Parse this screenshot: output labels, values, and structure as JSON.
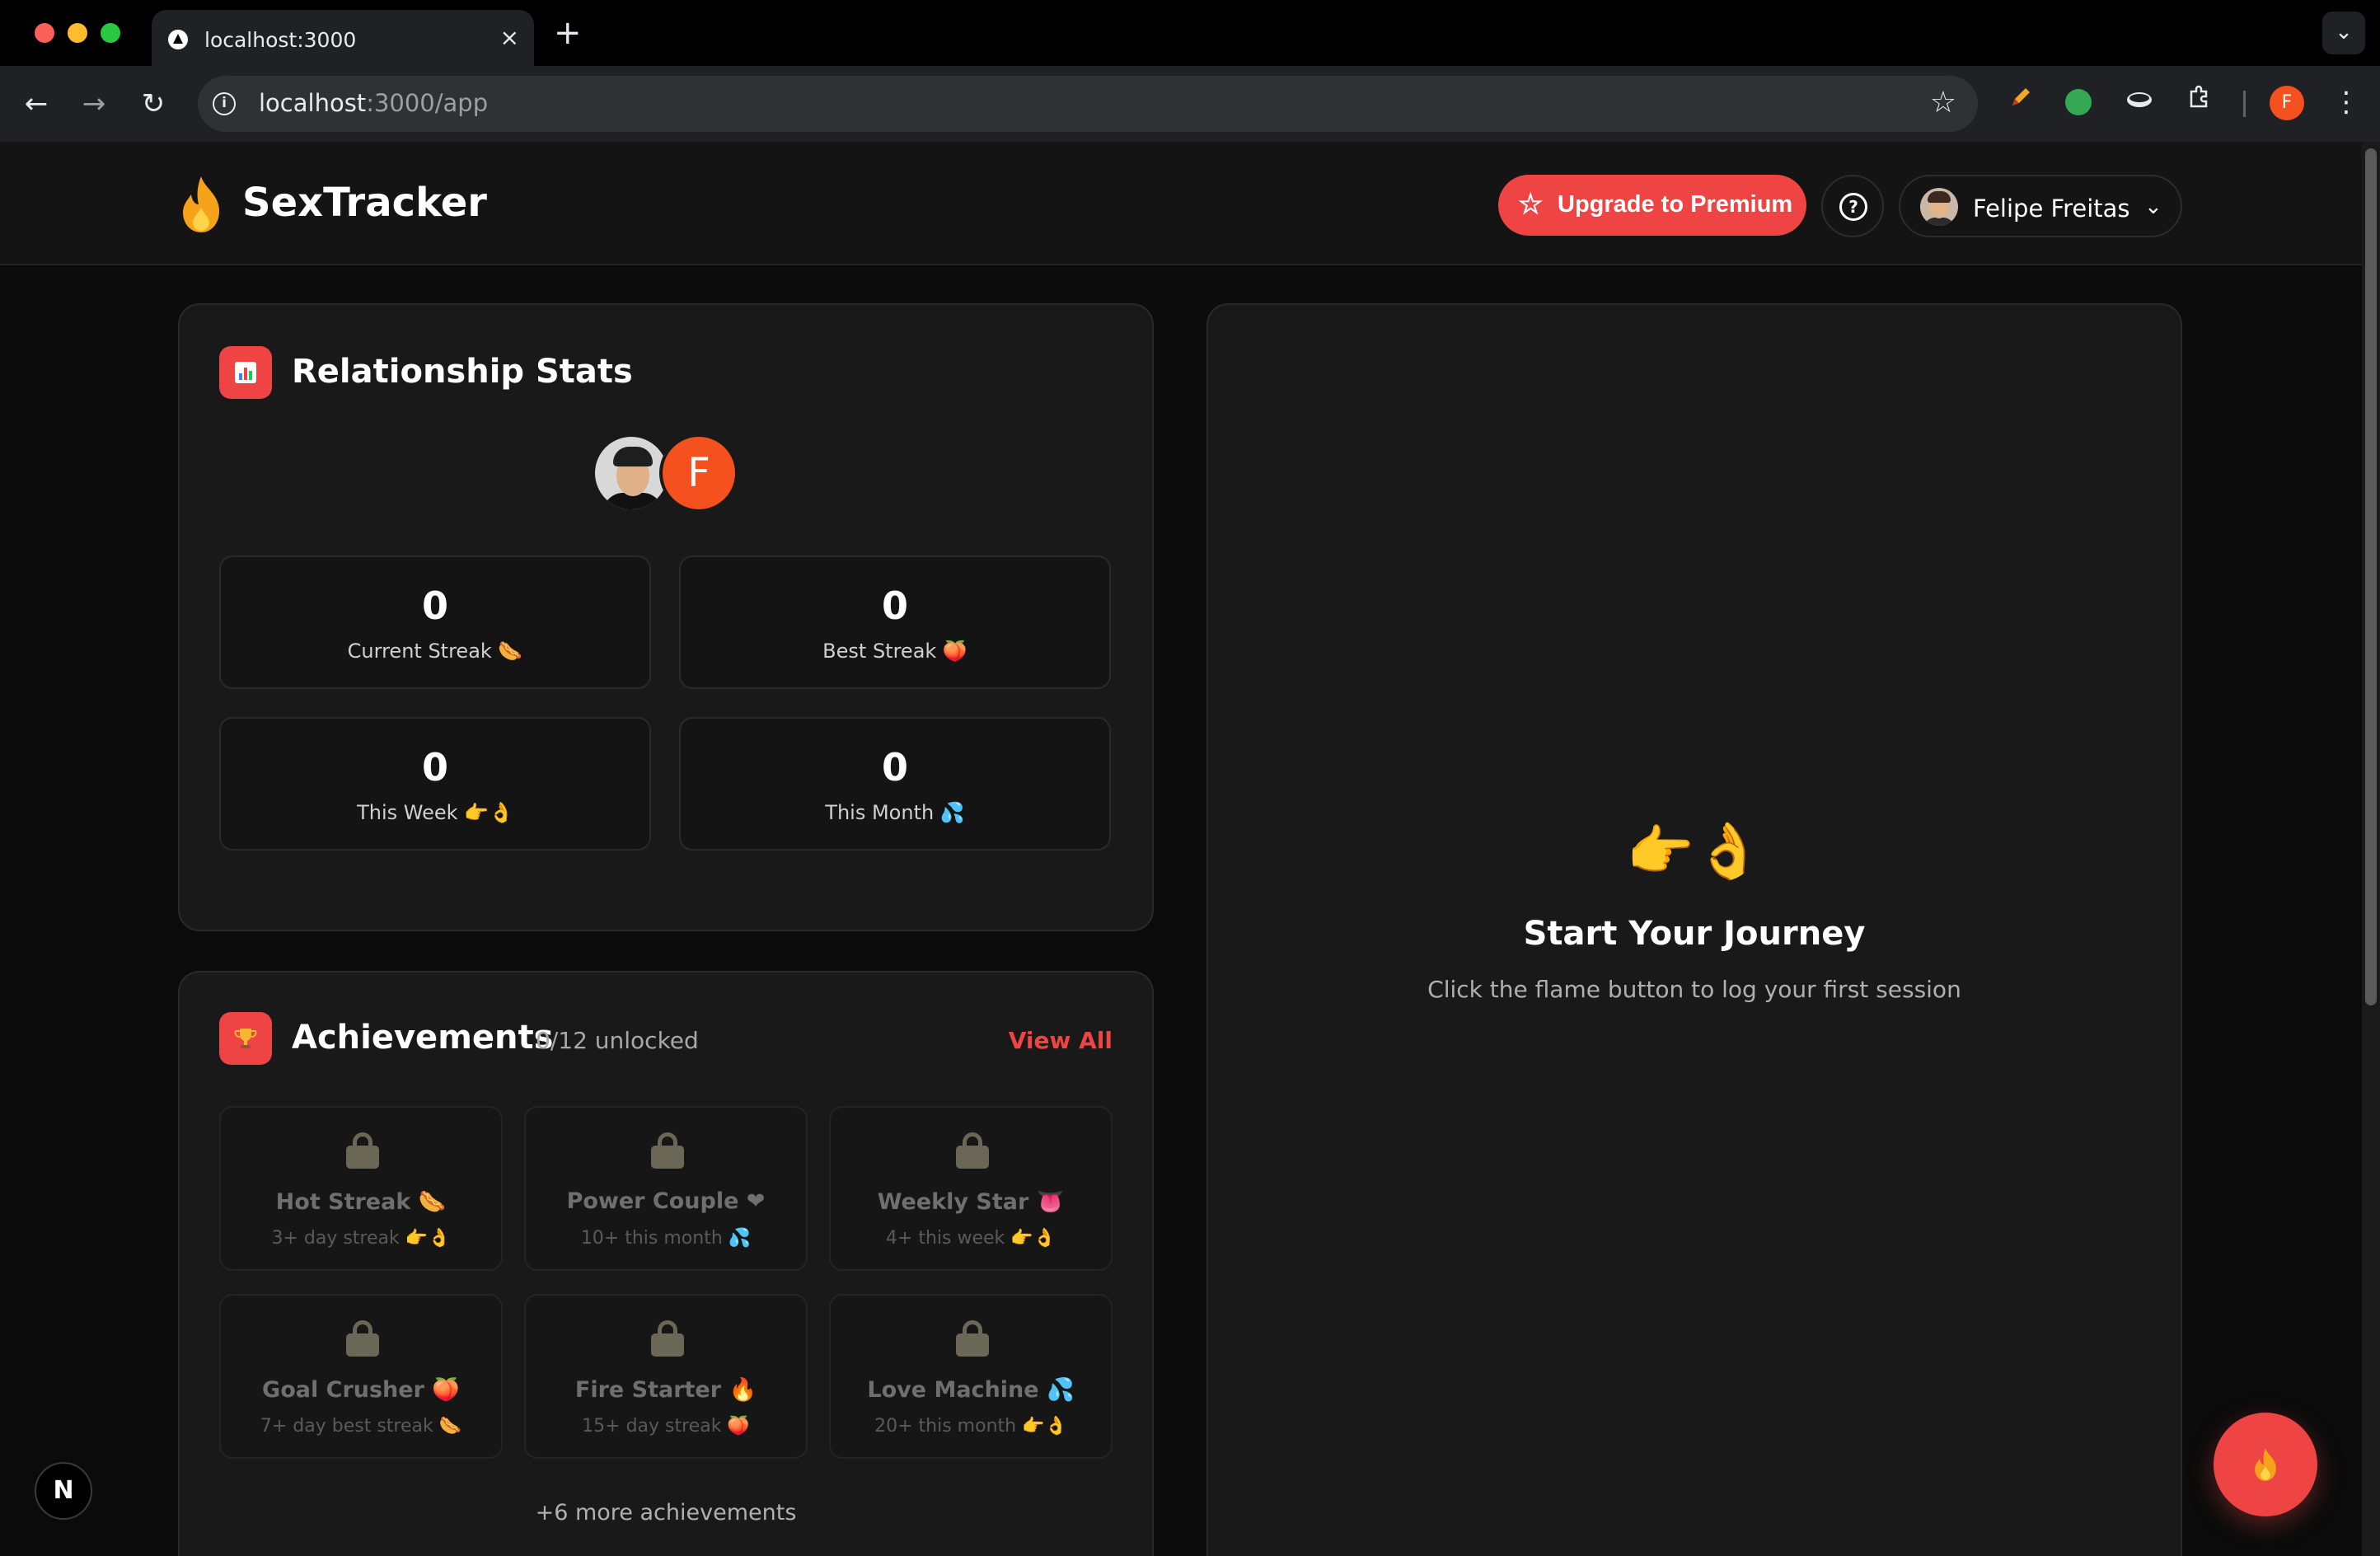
{
  "browser": {
    "tab_title": "localhost:3000",
    "tab_close": "×",
    "new_tab": "+",
    "tab_search": "⌄",
    "url_host": "localhost",
    "url_path": ":3000/app",
    "info": "i",
    "nav_back": "←",
    "nav_forward": "→",
    "nav_reload": "↻",
    "star": "☆",
    "profile_initial": "F",
    "menu": "⋮"
  },
  "header": {
    "brand": "SexTracker",
    "upgrade_label": "Upgrade to Premium",
    "upgrade_icon": "☆",
    "help": "?",
    "user_name": "Felipe Freitas",
    "chevron": "⌄",
    "accent": "#ef4444"
  },
  "stats": {
    "icon": "▮",
    "title": "Relationship Stats",
    "partner_initial": "F",
    "items": [
      {
        "value": "0",
        "label": "Current Streak 🌭"
      },
      {
        "value": "0",
        "label": "Best Streak 🍑"
      },
      {
        "value": "0",
        "label": "This Week 👉👌"
      },
      {
        "value": "0",
        "label": "This Month 💦"
      }
    ]
  },
  "achievements": {
    "icon": "🏆",
    "title": "Achievements",
    "count": "0/12 unlocked",
    "view_all": "View All",
    "items": [
      {
        "name": "Hot Streak 🌭",
        "desc": "3+ day streak 👉👌"
      },
      {
        "name": "Power Couple ❤",
        "desc": "10+ this month 💦"
      },
      {
        "name": "Weekly Star 👅",
        "desc": "4+ this week 👉👌"
      },
      {
        "name": "Goal Crusher 🍑",
        "desc": "7+ day best streak 🌭"
      },
      {
        "name": "Fire Starter 🔥",
        "desc": "15+ day streak 🍑"
      },
      {
        "name": "Love Machine 💦",
        "desc": "20+ this month 👉👌"
      }
    ],
    "more": "+6 more achievements"
  },
  "journey": {
    "emoji": "👉👌",
    "title": "Start Your Journey",
    "subtitle": "Click the flame button to log your first session"
  },
  "overlay": {
    "next_badge": "N"
  }
}
